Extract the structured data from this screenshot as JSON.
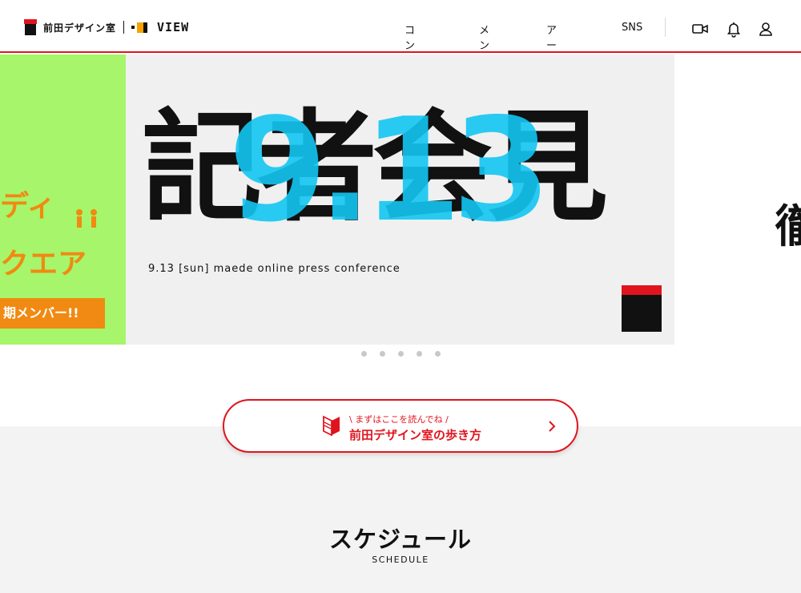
{
  "header": {
    "logo_text": "前田デザイン室",
    "logo_view": "VIEW",
    "nav": [
      "コンテンツ",
      "メンバー",
      "アーカイブ",
      "SNS"
    ],
    "icons": [
      "video-camera-icon",
      "bell-icon",
      "user-icon"
    ]
  },
  "carousel": {
    "prev_slide": {
      "line1": "ディ",
      "line2": "クエア",
      "banner": "期メンバー!!",
      "people": "👥",
      "bg": "#a7f56b",
      "accent": "#f08a12"
    },
    "main_slide": {
      "kanji": "記者会見",
      "date": "9.13",
      "subtitle": "9.13 [sun] maede online press conference",
      "date_color": "#13c6f2"
    },
    "next_slide": {
      "glyph": "徹"
    },
    "dot_count": 5
  },
  "guide": {
    "kicker": "\\ まずはここを読んでね /",
    "title": "前田デザイン室の歩き方"
  },
  "schedule": {
    "title": "スケジュール",
    "subtitle": "SCHEDULE"
  },
  "colors": {
    "brand_red": "#e0141e",
    "dot_gray": "#c8c8c8",
    "section_bg": "#f3f3f3"
  }
}
